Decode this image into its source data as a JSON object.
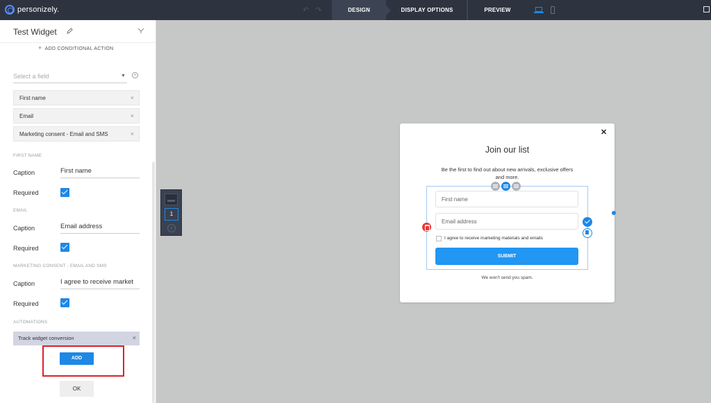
{
  "brand": {
    "logo_text": "personizely."
  },
  "topbar": {
    "tabs": [
      "DESIGN",
      "DISPLAY OPTIONS",
      "PREVIEW"
    ],
    "undo_icon": "↶",
    "redo_icon": "↷"
  },
  "panel": {
    "title": "Test Widget",
    "add_conditional": "ADD CONDITIONAL ACTION",
    "select_placeholder": "Select a field",
    "fields": [
      {
        "label": "First name"
      },
      {
        "label": "Email"
      },
      {
        "label": "Marketing consent - Email and SMS"
      }
    ],
    "sections": [
      {
        "heading": "FIRST NAME",
        "caption_label": "Caption",
        "caption_value": "First name",
        "required_label": "Required"
      },
      {
        "heading": "EMAIL",
        "caption_label": "Caption",
        "caption_value": "Email address",
        "required_label": "Required"
      },
      {
        "heading": "MARKETING CONSENT - EMAIL AND SMS",
        "caption_label": "Caption",
        "caption_value": "I agree to receive market",
        "required_label": "Required"
      }
    ],
    "automations_heading": "AUTOMATIONS",
    "automation_item": "Track widget conversion",
    "add_button": "ADD",
    "ok_button": "OK"
  },
  "step_nav": {
    "current_step": "1"
  },
  "popup": {
    "title": "Join our list",
    "subtitle": "Be the first to find out about new arrivals, exclusive offers and more.",
    "first_name_placeholder": "First name",
    "email_placeholder": "Email address",
    "consent_text": "I agree to receive marketing materials and emails",
    "submit_label": "SUBMIT",
    "footer_text": "We won't send you spam."
  },
  "colors": {
    "accent": "#1e88e5",
    "topbar_bg": "#2d3440",
    "canvas_bg": "#c6c7c7",
    "highlight": "#d6232a"
  }
}
